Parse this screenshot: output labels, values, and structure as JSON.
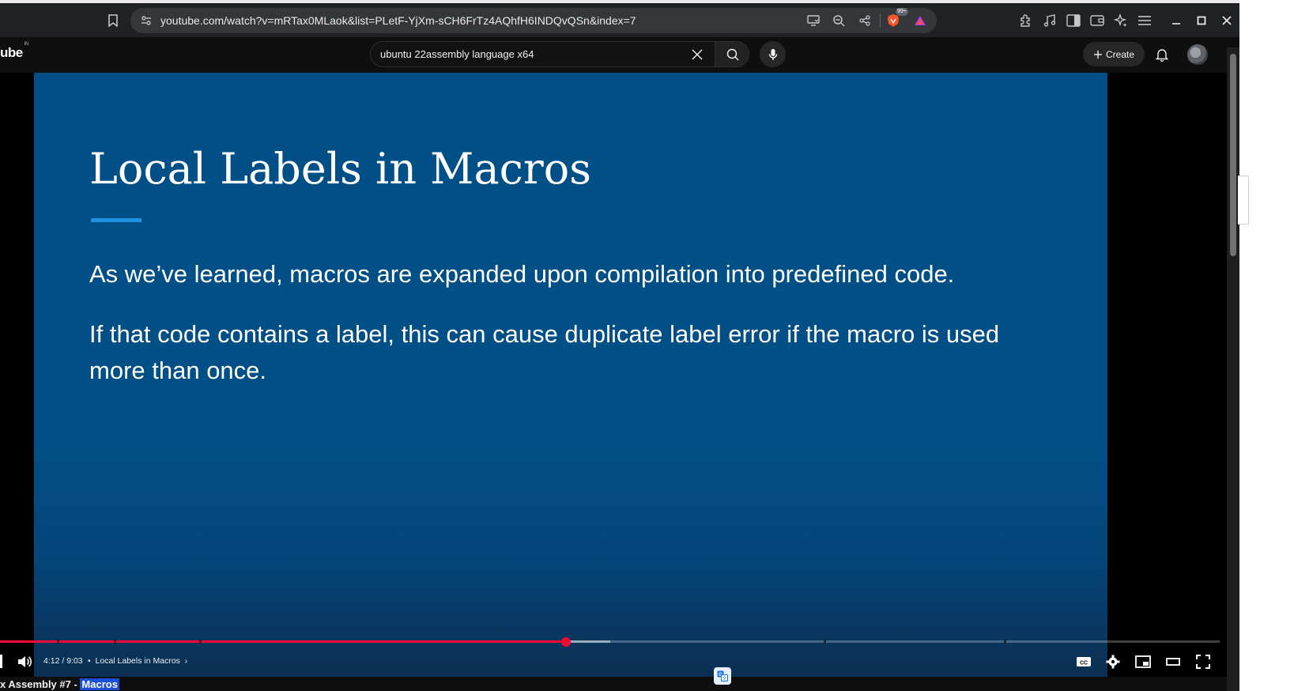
{
  "browser": {
    "url": "youtube.com/watch?v=mRTax0MLaok&list=PLetF-YjXm-sCH6FrTz4AQhfH6INDQvQSn&index=7",
    "shield_badge": "99+",
    "accent_color": "#f00a36"
  },
  "yt_header": {
    "logo_text": "ube",
    "logo_region": "IN",
    "search_value": "ubuntu 22assembly language x64",
    "create_label": "Create"
  },
  "slide": {
    "title": "Local Labels in Macros",
    "paragraphs": [
      "As we’ve learned, macros are expanded upon compilation into predefined code.",
      "If that code contains a label, this can cause duplicate label error if the macro is used more than once."
    ]
  },
  "player": {
    "current_time": "4:12",
    "duration": "9:03",
    "time_display": "4:12 / 9:03",
    "chapter": "Local Labels in Macros",
    "played_fraction": 0.4643,
    "buffered_fraction": 0.5
  },
  "under_title": {
    "text": "x Assembly #7 - ",
    "highlight": "Macros"
  }
}
